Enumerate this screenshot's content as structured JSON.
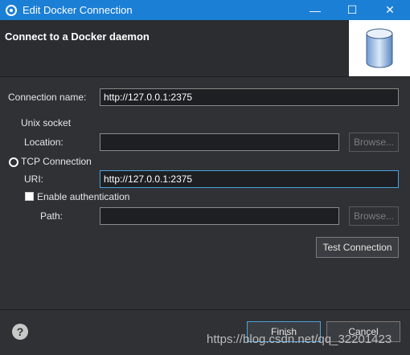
{
  "window": {
    "title": "Edit Docker Connection",
    "minimize_glyph": "—",
    "maximize_glyph": "☐",
    "close_glyph": "✕"
  },
  "header": {
    "title": "Connect to a Docker daemon",
    "image_icon": "database-cylinder-icon"
  },
  "form": {
    "connection_name_label": "Connection name:",
    "connection_name_value": "http://127.0.0.1:2375",
    "unix_socket_label": "Unix socket",
    "location_label": "Location:",
    "location_value": "",
    "browse_label": "Browse...",
    "tcp_label": "TCP Connection",
    "uri_label": "URI:",
    "uri_value": "http://127.0.0.1:2375",
    "enable_auth_label": "Enable authentication",
    "path_label": "Path:",
    "path_value": "",
    "test_connection_label": "Test Connection"
  },
  "footer": {
    "help_glyph": "?",
    "finish_label": "Finish",
    "cancel_label": "Cancel"
  },
  "watermark": "https://blog.csdn.net/qq_32201423",
  "colors": {
    "titlebar": "#1b7fd6",
    "background": "#2f3135",
    "input_background": "#1e1f22",
    "focus_border": "#4aa3df"
  }
}
